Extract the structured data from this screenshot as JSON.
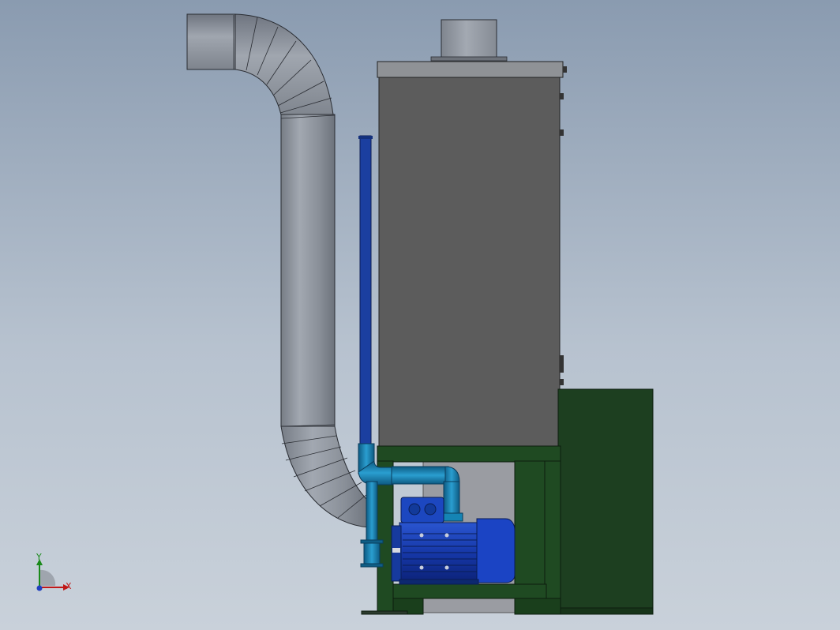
{
  "triad": {
    "x_label": "X",
    "y_label": "Y",
    "x_color": "#c01818",
    "y_color": "#1a8a1a",
    "z_color": "#1f3fbf"
  },
  "colors": {
    "duct": "#8f959e",
    "cabinet": "#5c5c5c",
    "frame": "#1f4a22",
    "pipe_blue": "#1580b0",
    "drain_blue": "#1b3fa0",
    "motor_blue": "#1740b5"
  }
}
